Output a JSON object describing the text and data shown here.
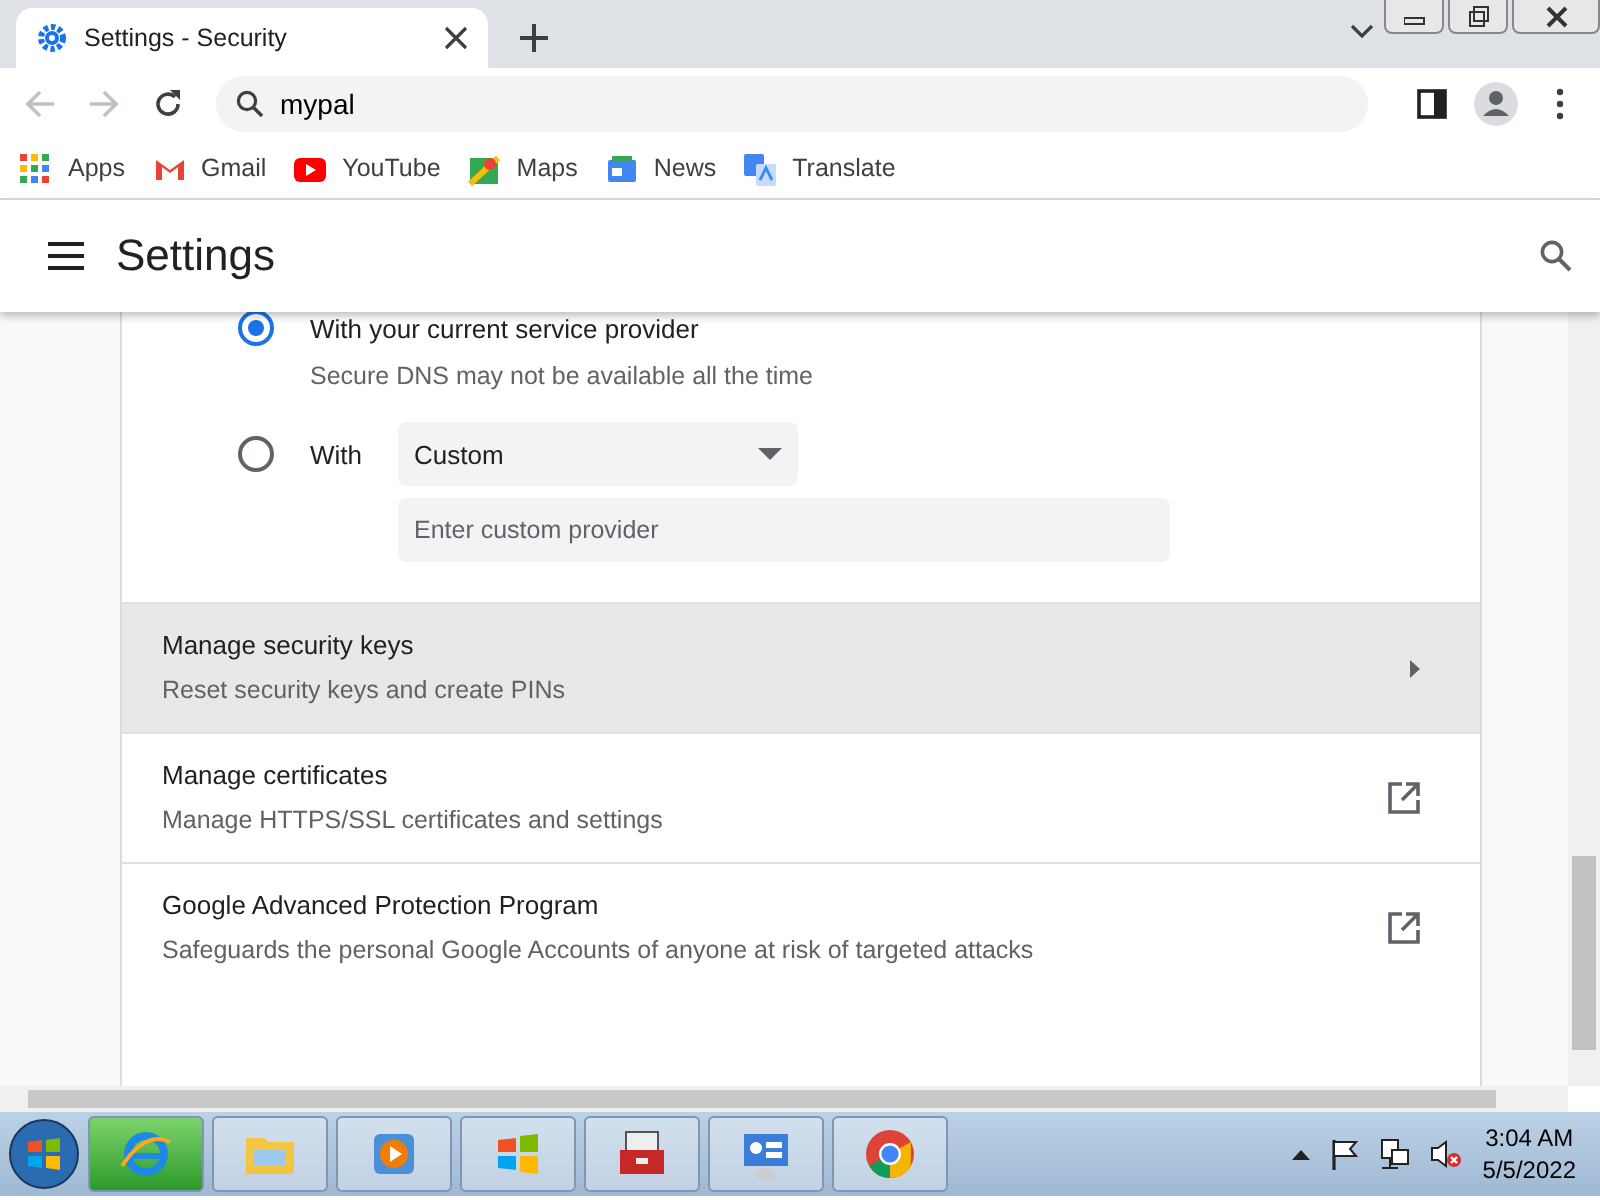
{
  "tab": {
    "title": "Settings - Security"
  },
  "address": {
    "value": "mypal"
  },
  "bookmarks": [
    {
      "label": "Apps",
      "kind": "apps"
    },
    {
      "label": "Gmail",
      "kind": "gmail"
    },
    {
      "label": "YouTube",
      "kind": "youtube"
    },
    {
      "label": "Maps",
      "kind": "maps"
    },
    {
      "label": "News",
      "kind": "news"
    },
    {
      "label": "Translate",
      "kind": "translate"
    }
  ],
  "header": {
    "title": "Settings"
  },
  "dns_options": [
    {
      "label": "With your current service provider",
      "description": "Secure DNS may not be available all the time",
      "selected": true,
      "kind": "plain"
    },
    {
      "label": "With",
      "selected": false,
      "kind": "custom",
      "dropdown": "Custom",
      "placeholder": "Enter custom provider"
    }
  ],
  "rows": [
    {
      "title": "Manage security keys",
      "subtitle": "Reset security keys and create PINs",
      "kind": "arrow",
      "hovered": true
    },
    {
      "title": "Manage certificates",
      "subtitle": "Manage HTTPS/SSL certificates and settings",
      "kind": "external",
      "hovered": false
    },
    {
      "title": "Google Advanced Protection Program",
      "subtitle": "Safeguards the personal Google Accounts of anyone at risk of targeted attacks",
      "kind": "external",
      "hovered": false
    }
  ],
  "clock": {
    "time": "3:04 AM",
    "date": "5/5/2022"
  }
}
